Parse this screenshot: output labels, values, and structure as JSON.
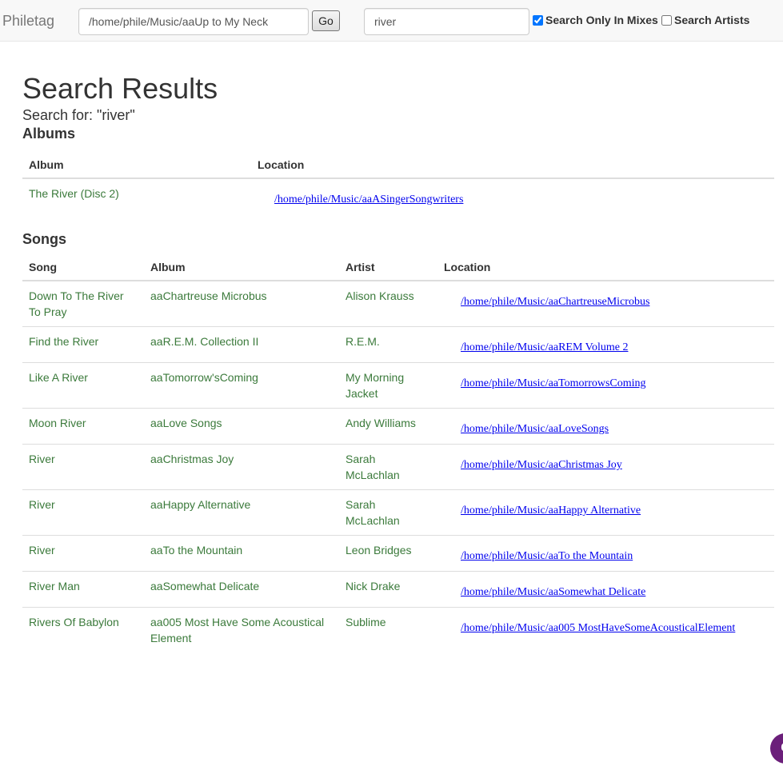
{
  "navbar": {
    "brand": "Philetag",
    "path_value": "/home/phile/Music/aaUp to My Neck",
    "go_label": "Go",
    "search_value": "river",
    "mixes_label": "Search Only In Mixes",
    "mixes_checked": true,
    "artists_label": "Search Artists",
    "artists_checked": false
  },
  "page": {
    "title": "Search Results",
    "search_for": "Search for: \"river\""
  },
  "albums": {
    "title": "Albums",
    "headers": [
      "Album",
      "Location"
    ],
    "rows": [
      {
        "album": "The River (Disc 2)",
        "location": "/home/phile/Music/aaASingerSongwriters"
      }
    ]
  },
  "songs": {
    "title": "Songs",
    "headers": [
      "Song",
      "Album",
      "Artist",
      "Location"
    ],
    "rows": [
      {
        "song": "Down To The River To Pray",
        "album": "aaChartreuse Microbus",
        "artist": "Alison Krauss",
        "location": "/home/phile/Music/aaChartreuseMicrobus"
      },
      {
        "song": "Find the River",
        "album": "aaR.E.M. Collection II",
        "artist": "R.E.M.",
        "location": "/home/phile/Music/aaREM Volume 2"
      },
      {
        "song": "Like A River",
        "album": "aaTomorrow'sComing",
        "artist": "My Morning Jacket",
        "location": "/home/phile/Music/aaTomorrowsComing"
      },
      {
        "song": "Moon River",
        "album": "aaLove Songs",
        "artist": "Andy Williams",
        "location": "/home/phile/Music/aaLoveSongs"
      },
      {
        "song": "River",
        "album": "aaChristmas Joy",
        "artist": "Sarah McLachlan",
        "location": "/home/phile/Music/aaChristmas Joy"
      },
      {
        "song": "River",
        "album": "aaHappy Alternative",
        "artist": "Sarah McLachlan",
        "location": "/home/phile/Music/aaHappy Alternative"
      },
      {
        "song": "River",
        "album": "aaTo the Mountain",
        "artist": "Leon Bridges",
        "location": "/home/phile/Music/aaTo the Mountain"
      },
      {
        "song": "River Man",
        "album": "aaSomewhat Delicate",
        "artist": "Nick Drake",
        "location": "/home/phile/Music/aaSomewhat Delicate"
      },
      {
        "song": "Rivers Of Babylon",
        "album": "aa005 Most Have Some Acoustical Element",
        "artist": "Sublime",
        "location": "/home/phile/Music/aa005 MostHaveSomeAcousticalElement"
      }
    ]
  },
  "chat_bubble": {
    "label": "C",
    "color": "#6b1f7a"
  }
}
